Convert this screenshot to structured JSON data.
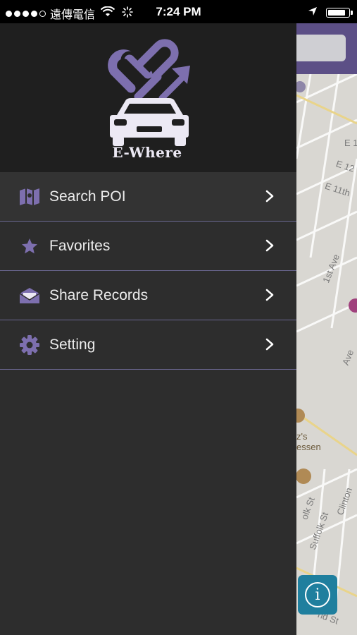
{
  "status_bar": {
    "carrier": "遠傳電信",
    "time": "7:24 PM",
    "signal_bars_filled": 4,
    "battery_level": 0.9
  },
  "app": {
    "logo_text": "E-Where",
    "accent_color": "#7d6fae"
  },
  "menu": {
    "items": [
      {
        "label": "Search POI",
        "icon": "map-icon"
      },
      {
        "label": "Favorites",
        "icon": "star-icon"
      },
      {
        "label": "Share Records",
        "icon": "envelope-icon"
      },
      {
        "label": "Setting",
        "icon": "gear-icon"
      }
    ]
  },
  "map": {
    "street_labels": [
      "E 1",
      "E 12",
      "E 11th",
      "1st Ave",
      "Ave",
      "z's",
      "essen",
      "olk St",
      "Suffolk St",
      "Clinton",
      "nd St"
    ]
  }
}
